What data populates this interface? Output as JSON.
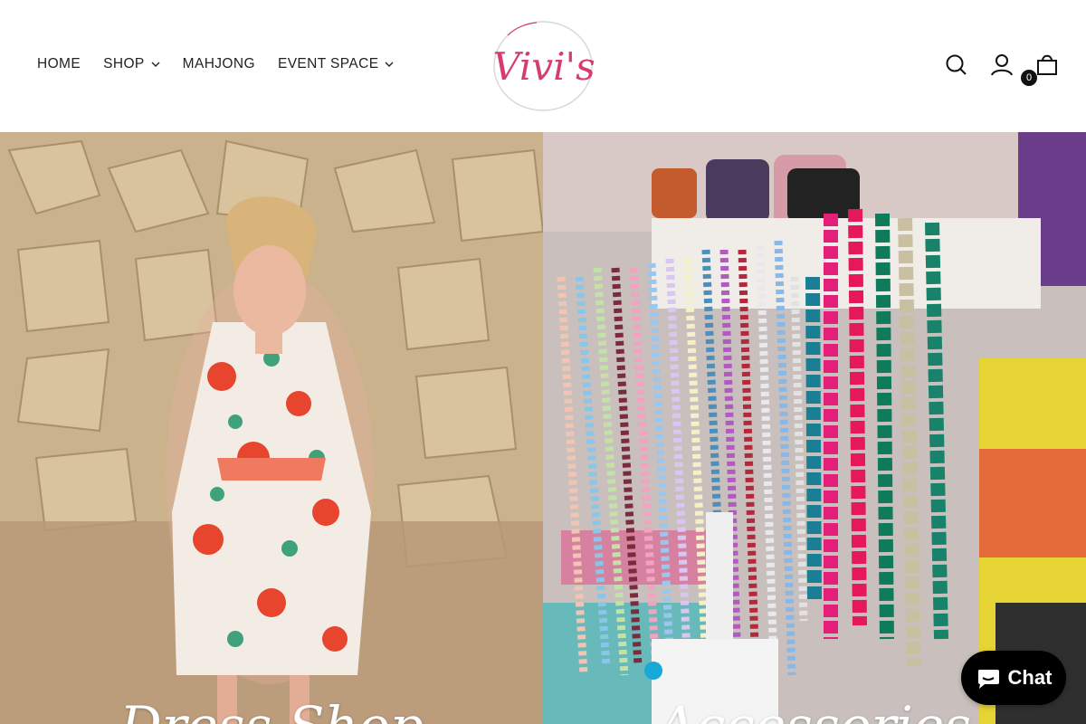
{
  "nav": {
    "home": "HOME",
    "shop": "SHOP",
    "mahjong": "MAHJONG",
    "event_space": "EVENT SPACE"
  },
  "logo": {
    "text": "Vivi's",
    "color": "#d63c6e"
  },
  "header_icons": [
    "search-icon",
    "account-icon",
    "cart-icon"
  ],
  "cart": {
    "count": "0"
  },
  "hero": {
    "left_title": "Dress Shop",
    "right_title": "Accessories"
  },
  "chat": {
    "label": "Chat"
  }
}
